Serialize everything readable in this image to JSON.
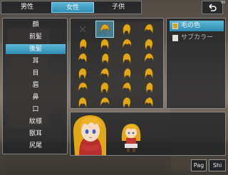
{
  "fps": "60",
  "gender_tabs": [
    {
      "label": "男性",
      "active": false
    },
    {
      "label": "女性",
      "active": true
    },
    {
      "label": "子供",
      "active": false
    }
  ],
  "parts": [
    {
      "label": "顔",
      "active": false
    },
    {
      "label": "前髪",
      "active": false
    },
    {
      "label": "後髪",
      "active": true
    },
    {
      "label": "耳",
      "active": false
    },
    {
      "label": "目",
      "active": false
    },
    {
      "label": "眉",
      "active": false
    },
    {
      "label": "鼻",
      "active": false
    },
    {
      "label": "口",
      "active": false
    },
    {
      "label": "紋様",
      "active": false
    },
    {
      "label": "獣耳",
      "active": false
    },
    {
      "label": "尻尾",
      "active": false
    }
  ],
  "color_options": [
    {
      "label": "毛の色",
      "active": true,
      "color": "#d9a020"
    },
    {
      "label": "サブカラー",
      "active": false,
      "color": "#e8e4dc"
    }
  ],
  "hair_grid": {
    "rows": 6,
    "cols": 4,
    "selected_index": 1,
    "empty_index": 0,
    "hair_color": "#e0a818"
  },
  "bottom_buttons": {
    "page_label": "Pag",
    "shift_label": "Shi"
  },
  "colors": {
    "accent": "#3a9cc2",
    "hair": "#e0a818",
    "panel_bg": "#1c1e22"
  }
}
